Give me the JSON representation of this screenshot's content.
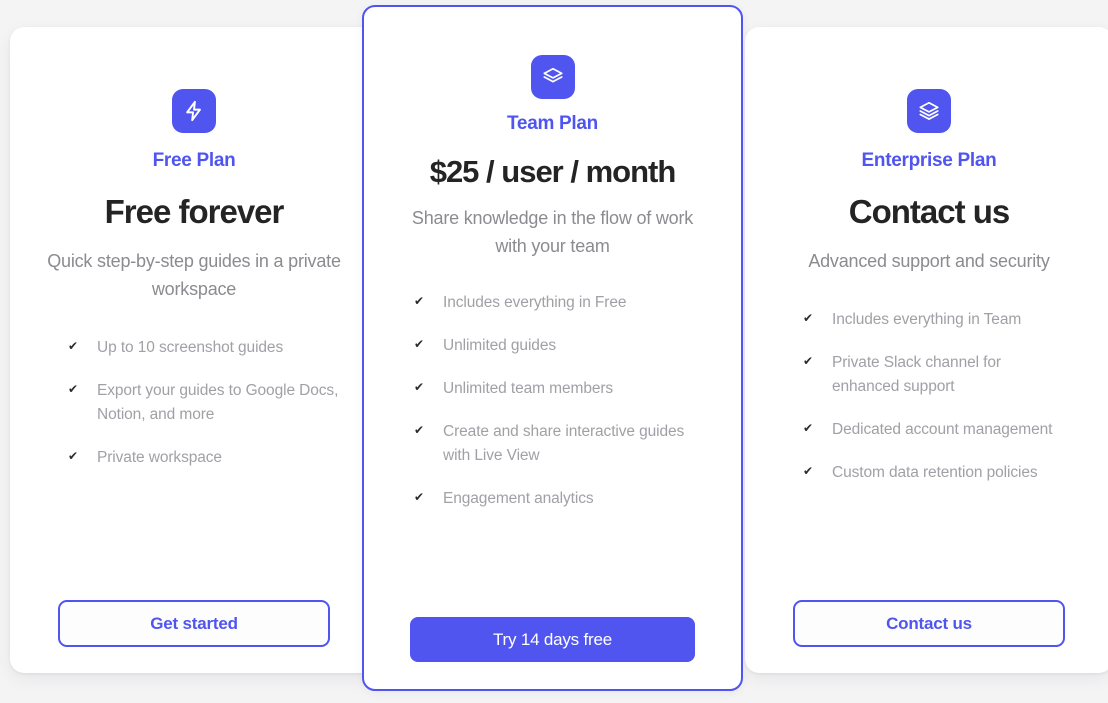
{
  "theme": {
    "accent": "#4f55ee",
    "page_background": "#f4f4f5",
    "card_background": "#ffffff",
    "heading_color": "#242424",
    "muted_text": "#a0a0a6",
    "check_glyph": "✔"
  },
  "plans": [
    {
      "icon": "lightning-bolt-icon",
      "name": "Free Plan",
      "headline": "Free forever",
      "description": "Quick step-by-step guides in a private workspace",
      "features": [
        "Up to 10 screenshot guides",
        "Export your guides to Google Docs, Notion, and more",
        "Private workspace"
      ],
      "cta_label": "Get started",
      "cta_style": "outline",
      "featured": false
    },
    {
      "icon": "layers-stack-icon",
      "name": "Team Plan",
      "headline": "$25 / user / month",
      "description": "Share knowledge in the flow of work with your team",
      "features": [
        "Includes everything in Free",
        "Unlimited guides",
        "Unlimited team members",
        "Create and share interactive guides with Live View",
        "Engagement analytics"
      ],
      "cta_label": "Try 14 days free",
      "cta_style": "solid",
      "featured": true
    },
    {
      "icon": "layers-stack-icon",
      "name": "Enterprise Plan",
      "headline": "Contact us",
      "description": "Advanced support and security",
      "features": [
        "Includes everything in Team",
        "Private Slack channel for enhanced support",
        "Dedicated account management",
        "Custom data retention policies"
      ],
      "cta_label": "Contact us",
      "cta_style": "outline",
      "featured": false
    }
  ]
}
